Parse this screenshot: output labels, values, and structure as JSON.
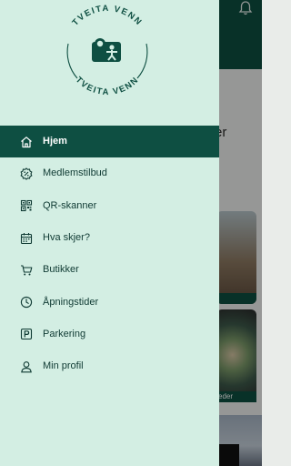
{
  "background": {
    "heading_fragment": "er",
    "card_label_fragment": "eder"
  },
  "logo": {
    "text_top": "TVEITA VENN",
    "text_bottom": "TVEITA VENN"
  },
  "menu": {
    "items": [
      {
        "label": "Hjem",
        "icon": "home-icon",
        "active": true
      },
      {
        "label": "Medlemstilbud",
        "icon": "percent-badge-icon",
        "active": false
      },
      {
        "label": "QR-skanner",
        "icon": "qr-code-icon",
        "active": false
      },
      {
        "label": "Hva skjer?",
        "icon": "calendar-icon",
        "active": false
      },
      {
        "label": "Butikker",
        "icon": "cart-icon",
        "active": false
      },
      {
        "label": "Åpningstider",
        "icon": "clock-icon",
        "active": false
      },
      {
        "label": "Parkering",
        "icon": "parking-icon",
        "active": false
      },
      {
        "label": "Min profil",
        "icon": "user-icon",
        "active": false
      }
    ]
  },
  "colors": {
    "brand_green": "#0e4f42",
    "drawer_bg": "#d3eee3",
    "text_dark": "#0f3a33"
  }
}
